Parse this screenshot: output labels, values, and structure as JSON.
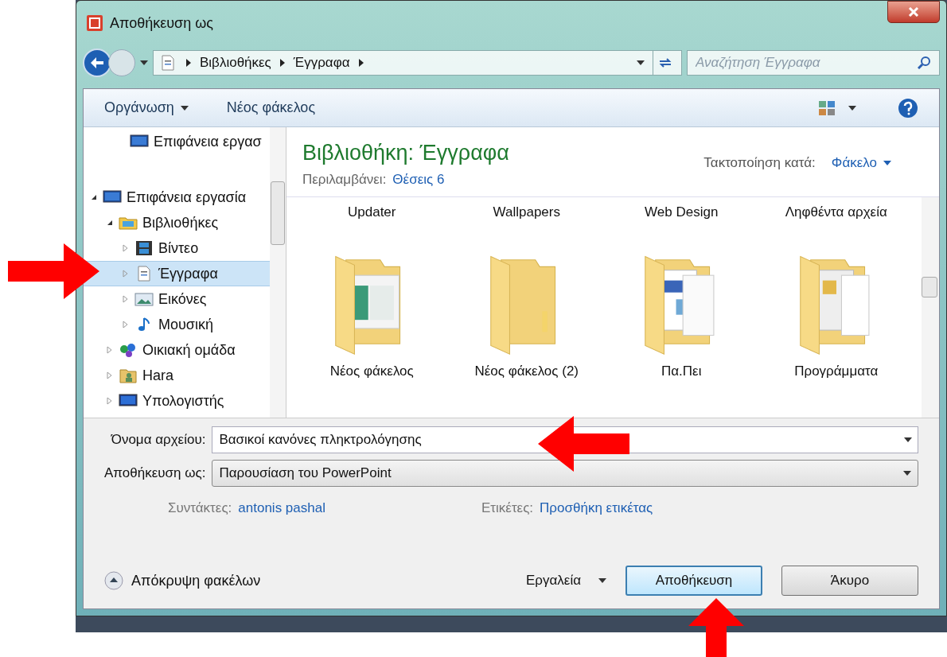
{
  "window": {
    "title": "Αποθήκευση ως"
  },
  "address_bar": {
    "crumbs": [
      "Βιβλιοθήκες",
      "Έγγραφα"
    ]
  },
  "search": {
    "placeholder": "Αναζήτηση Έγγραφα"
  },
  "toolbar": {
    "items": [
      "Οργάνωση",
      "Νέος φάκελος"
    ]
  },
  "sidebar": {
    "favorites": [
      {
        "label": "Επιφάνεια εργασ",
        "kind": "desktop"
      }
    ],
    "items": [
      {
        "label": "Επιφάνεια εργασία",
        "kind": "desktop",
        "expanded": true,
        "selected": false,
        "children": [
          {
            "label": "Βιβλιοθήκες",
            "kind": "libraries",
            "expanded": true,
            "selected": false,
            "children": [
              {
                "label": "Βίντεο",
                "kind": "video",
                "expanded": false,
                "selected": false
              },
              {
                "label": "Έγγραφα",
                "kind": "document",
                "expanded": false,
                "selected": true
              },
              {
                "label": "Εικόνες",
                "kind": "pictures",
                "expanded": false,
                "selected": false
              },
              {
                "label": "Μουσική",
                "kind": "music",
                "expanded": false,
                "selected": false
              }
            ]
          },
          {
            "label": "Οικιακή ομάδα",
            "kind": "homegroup",
            "expanded": false,
            "selected": false
          },
          {
            "label": "Hara",
            "kind": "user",
            "expanded": false,
            "selected": false
          },
          {
            "label": "Υπολογιστής",
            "kind": "computer",
            "expanded": false,
            "selected": false
          }
        ]
      }
    ]
  },
  "library": {
    "title": "Βιβλιοθήκη: Έγγραφα",
    "includes_label": "Περιλαμβάνει:",
    "includes_link": "Θέσεις 6",
    "arrange_label": "Τακτοποίηση κατά:",
    "arrange_value": "Φάκελο"
  },
  "files": [
    {
      "name": "Updater",
      "kind": "label_only"
    },
    {
      "name": "Wallpapers",
      "kind": "label_only"
    },
    {
      "name": "Web Design",
      "kind": "label_only"
    },
    {
      "name": "Ληφθέντα αρχεία",
      "kind": "label_only"
    },
    {
      "name": "Νέος φάκελος",
      "kind": "folder_screens"
    },
    {
      "name": "Νέος φάκελος (2)",
      "kind": "folder_empty"
    },
    {
      "name": "Πα.Πει",
      "kind": "folder_docs"
    },
    {
      "name": "Προγράμματα",
      "kind": "folder_papers"
    }
  ],
  "form": {
    "filename_label": "Όνομα αρχείου:",
    "filename_value": "Βασικοί κανόνες πληκτρολόγησης",
    "type_label": "Αποθήκευση ως:",
    "type_value": "Παρουσίαση του PowerPoint",
    "authors_label": "Συντάκτες:",
    "authors_value": "antonis pashal",
    "tags_label": "Ετικέτες:",
    "tags_value": "Προσθήκη ετικέτας"
  },
  "footer": {
    "hide_folders": "Απόκρυψη φακέλων",
    "tools": "Εργαλεία",
    "buttons": [
      {
        "label": "Αποθήκευση",
        "default": true
      },
      {
        "label": "Άκυρο",
        "default": false
      }
    ]
  }
}
